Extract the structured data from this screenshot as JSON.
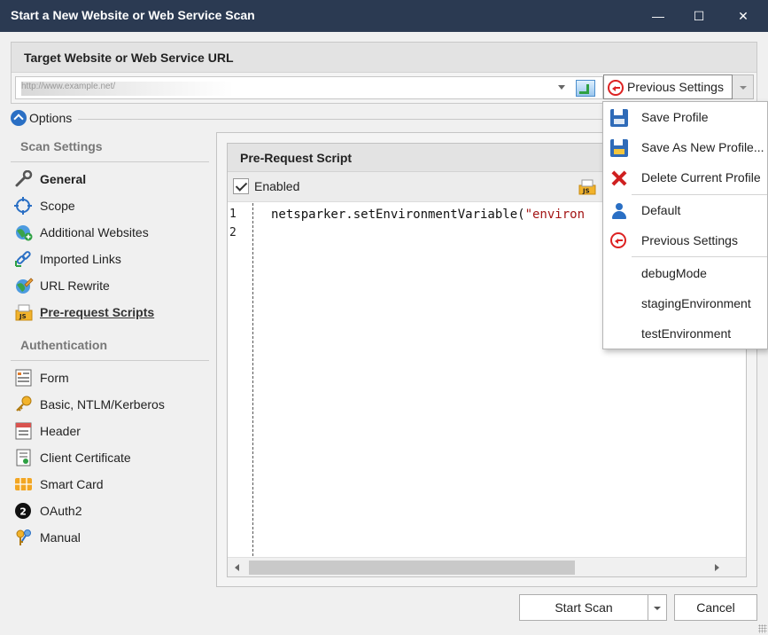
{
  "window": {
    "title": "Start a New Website or Web Service Scan",
    "minimize_glyph": "—",
    "maximize_glyph": "☐",
    "close_glyph": "✕"
  },
  "url_panel": {
    "header": "Target Website or Web Service URL",
    "url_value": "http://www.example.net/",
    "previous_settings_label": "Previous Settings"
  },
  "options": {
    "label": "Options"
  },
  "sidebar": {
    "scan_settings_heading": "Scan Settings",
    "scan_items": [
      {
        "label": "General",
        "icon": "wrench-icon"
      },
      {
        "label": "Scope",
        "icon": "crosshair-icon"
      },
      {
        "label": "Additional Websites",
        "icon": "globe-add-icon"
      },
      {
        "label": "Imported Links",
        "icon": "link-import-icon"
      },
      {
        "label": "URL Rewrite",
        "icon": "globe-pencil-icon"
      },
      {
        "label": "Pre-request Scripts",
        "icon": "js-file-icon"
      }
    ],
    "auth_heading": "Authentication",
    "auth_items": [
      {
        "label": "Form",
        "icon": "form-icon"
      },
      {
        "label": "Basic, NTLM/Kerberos",
        "icon": "key-icon"
      },
      {
        "label": "Header",
        "icon": "header-icon"
      },
      {
        "label": "Client Certificate",
        "icon": "certificate-icon"
      },
      {
        "label": "Smart Card",
        "icon": "smart-card-icon"
      },
      {
        "label": "OAuth2",
        "icon": "oauth2-icon"
      },
      {
        "label": "Manual",
        "icon": "manual-keys-icon"
      }
    ]
  },
  "pre_request": {
    "header": "Pre-Request Script",
    "enabled_label": "Enabled",
    "enabled": true,
    "line_numbers": [
      "1",
      "2"
    ],
    "code_prefix": "netsparker.setEnvironmentVariable(",
    "code_string": "\"environ"
  },
  "footer": {
    "start_scan_label": "Start Scan",
    "cancel_label": "Cancel"
  },
  "menu": {
    "items": [
      {
        "label": "Save Profile",
        "icon": "save-icon"
      },
      {
        "label": "Save As New Profile...",
        "icon": "save-as-icon"
      },
      {
        "label": "Delete Current Profile",
        "icon": "delete-icon"
      },
      {
        "label": "Default",
        "icon": "user-icon"
      },
      {
        "label": "Previous Settings",
        "icon": "previous-settings-icon"
      },
      {
        "label": "debugMode",
        "icon": ""
      },
      {
        "label": "stagingEnvironment",
        "icon": ""
      },
      {
        "label": "testEnvironment",
        "icon": ""
      }
    ]
  },
  "colors": {
    "titlebar": "#2b3a52",
    "accent_blue": "#2a6fc4",
    "delete_red": "#cf2020"
  }
}
